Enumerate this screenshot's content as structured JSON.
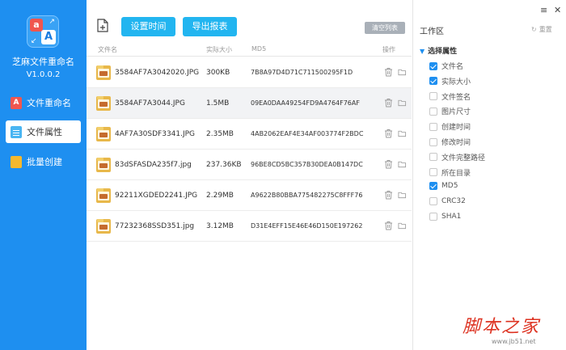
{
  "app": {
    "name": "芝麻文件重命名",
    "version": "V1.0.0.2"
  },
  "nav": [
    {
      "label": "文件重命名",
      "active": false
    },
    {
      "label": "文件属性",
      "active": true
    },
    {
      "label": "批量创建",
      "active": false
    }
  ],
  "toolbar": {
    "set_time": "设置时间",
    "export_report": "导出报表",
    "clear_list": "清空列表"
  },
  "table": {
    "headers": {
      "name": "文件名",
      "size": "实际大小",
      "md5": "MD5",
      "ops": "操作"
    },
    "rows": [
      {
        "name": "3584AF7A3042020.JPG",
        "size": "300KB",
        "md5": "7B8A97D4D71C711500295F1D"
      },
      {
        "name": "3584AF7A3044.JPG",
        "size": "1.5MB",
        "md5": "09EA0DAA49254FD9A4764F76AF"
      },
      {
        "name": "4AF7A30SDF3341.JPG",
        "size": "2.35MB",
        "md5": "4AB2062EAF4E34AF003774F2BDC"
      },
      {
        "name": "83dSFASDA235f7.jpg",
        "size": "237.36KB",
        "md5": "96BE8CD5BC357B30DEA0B147DC"
      },
      {
        "name": "92211XGDED2241.JPG",
        "size": "2.29MB",
        "md5": "A9622B80BBA775482275C8FFF76"
      },
      {
        "name": "77232368SSD351.jpg",
        "size": "3.12MB",
        "md5": "D31E4EFF15E46E46D150E197262"
      }
    ],
    "selected_index": 1
  },
  "work": {
    "title": "工作区",
    "reset": "重置",
    "section": "选择属性",
    "props": [
      {
        "label": "文件名",
        "checked": true
      },
      {
        "label": "实际大小",
        "checked": true
      },
      {
        "label": "文件签名",
        "checked": false
      },
      {
        "label": "图片尺寸",
        "checked": false
      },
      {
        "label": "创建时间",
        "checked": false
      },
      {
        "label": "修改时间",
        "checked": false
      },
      {
        "label": "文件完整路径",
        "checked": false
      },
      {
        "label": "所在目录",
        "checked": false
      },
      {
        "label": "MD5",
        "checked": true
      },
      {
        "label": "CRC32",
        "checked": false
      },
      {
        "label": "SHA1",
        "checked": false
      }
    ]
  },
  "watermark": {
    "text": "脚本之家",
    "sub": "www.jb51.net"
  },
  "icons": {
    "menu": "menu-icon",
    "close": "close-icon",
    "reset": "refresh-icon",
    "delete": "trash-icon",
    "open": "folder-icon",
    "add": "add-file-icon"
  },
  "colors": {
    "sidebar": "#1e8ff0",
    "button": "#22b5f0",
    "check": "#1e8ff0"
  }
}
